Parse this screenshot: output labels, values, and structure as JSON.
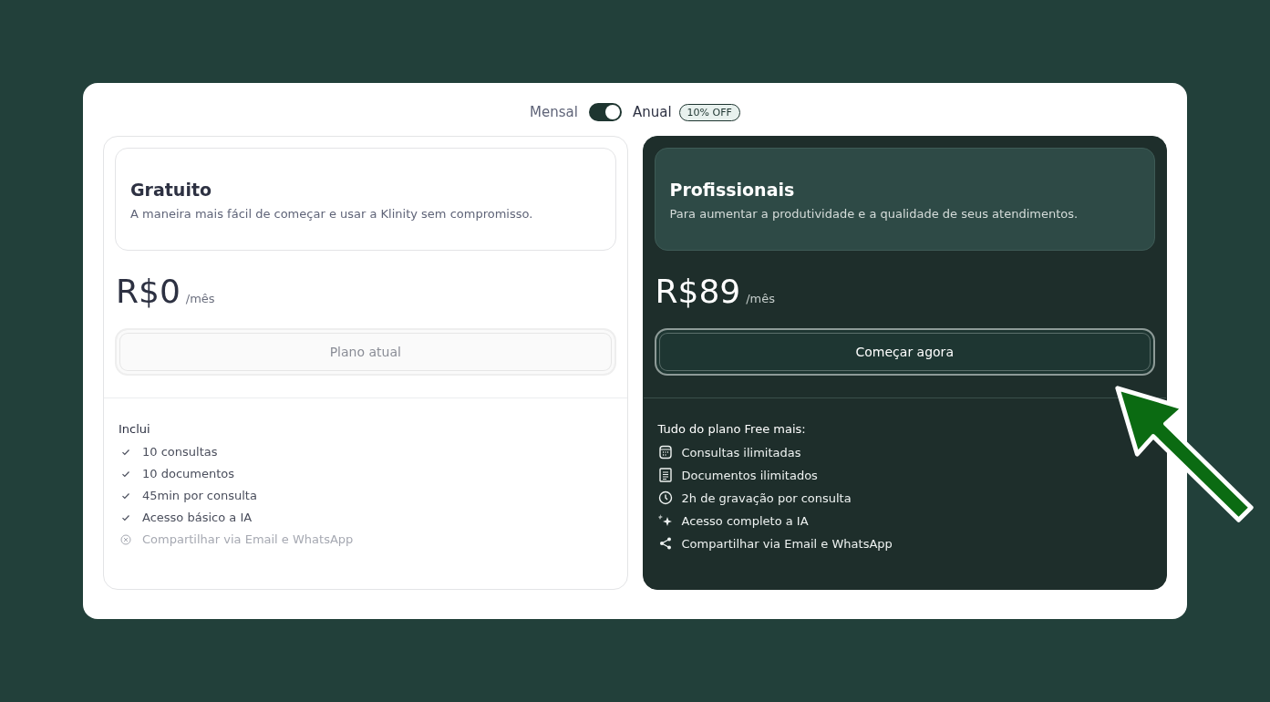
{
  "billing_toggle": {
    "left_label": "Mensal",
    "right_label": "Anual",
    "on": true,
    "badge": "10% OFF"
  },
  "plans": [
    {
      "name": "Gratuito",
      "highlighted": false,
      "description": "A maneira mais fácil de começar e usar a Klinity sem compromisso.",
      "price": "R$0",
      "period": "/mês",
      "button": {
        "label": "Plano atual",
        "disabled": true
      },
      "features_title": "Inclui",
      "features": [
        {
          "kind": "check",
          "label": "10 consultas"
        },
        {
          "kind": "check",
          "label": "10 documentos"
        },
        {
          "kind": "check",
          "label": "45min por consulta"
        },
        {
          "kind": "check",
          "label": "Acesso básico a IA"
        },
        {
          "kind": "excluded",
          "label": "Compartilhar via Email e WhatsApp"
        }
      ]
    },
    {
      "name": "Profissionais",
      "highlighted": true,
      "description": "Para aumentar a produtividade e a qualidade de seus atendimentos.",
      "price": "R$89",
      "period": "/mês",
      "button": {
        "label": "Começar agora",
        "disabled": false
      },
      "features_title": "Tudo do plano Free mais:",
      "features": [
        {
          "kind": "calendar",
          "label": "Consultas ilimitadas"
        },
        {
          "kind": "document",
          "label": "Documentos ilimitados"
        },
        {
          "kind": "clock",
          "label": "2h de gravação por consulta"
        },
        {
          "kind": "sparkle",
          "label": "Acesso completo a IA"
        },
        {
          "kind": "share",
          "label": "Compartilhar via Email e WhatsApp"
        }
      ]
    }
  ]
}
